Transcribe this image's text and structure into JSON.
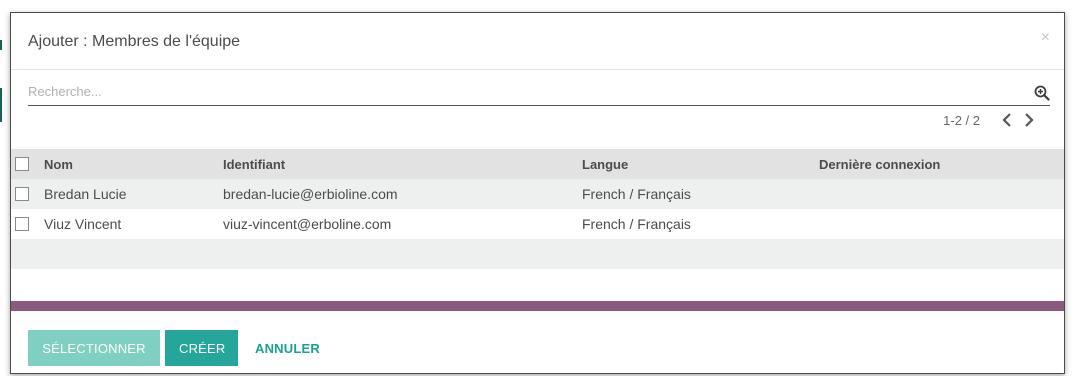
{
  "dialog": {
    "title": "Ajouter : Membres de l'équipe",
    "close_label": "×"
  },
  "search": {
    "placeholder": "Recherche..."
  },
  "pager": {
    "value": "1-2 / 2"
  },
  "table": {
    "headers": [
      "Nom",
      "Identifiant",
      "Langue",
      "Dernière connexion"
    ],
    "rows": [
      {
        "name": "Bredan Lucie",
        "login": "bredan-lucie@erbioline.com",
        "lang": "French / Français",
        "last": ""
      },
      {
        "name": "Viuz Vincent",
        "login": "viuz-vincent@erboline.com",
        "lang": "French / Français",
        "last": ""
      }
    ]
  },
  "footer": {
    "select_label": "SÉLECTIONNER",
    "create_label": "CRÉER",
    "cancel_label": "ANNULER"
  },
  "colors": {
    "primary": "#26a69a",
    "primary_light": "#7fcfc3",
    "divider": "#8b5b7f",
    "header_row": "#e2e2e2"
  },
  "icons": [
    "search-icon",
    "chevron-left-icon",
    "chevron-right-icon",
    "close-icon"
  ]
}
